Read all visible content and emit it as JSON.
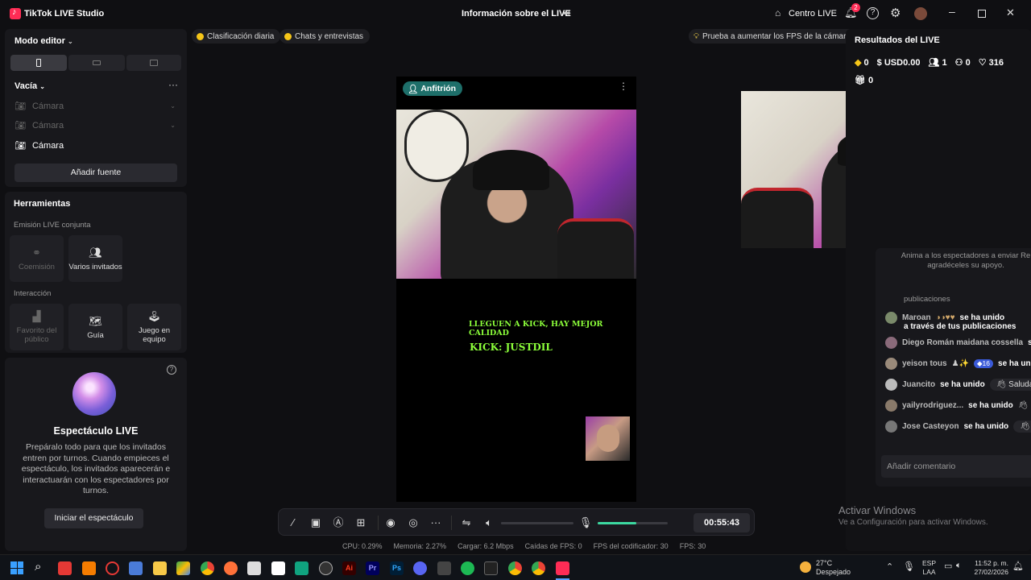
{
  "app": {
    "title": "TikTok LIVE Studio"
  },
  "header": {
    "center_title": "Información sobre el LIVE",
    "centro_live": "Centro LIVE",
    "notif_count": "2"
  },
  "left": {
    "mode_editor": "Modo editor",
    "scene_name": "Vacía",
    "sources": [
      {
        "label": "Cámara",
        "active": false
      },
      {
        "label": "Cámara",
        "active": false
      },
      {
        "label": "Cámara",
        "active": true
      }
    ],
    "add_source": "Añadir fuente",
    "tools_title": "Herramientas",
    "co_emission_title": "Emisión LIVE conjunta",
    "tools_co": [
      {
        "label": "Coemisión",
        "icon": "link-icon"
      },
      {
        "label": "Varios invitados",
        "icon": "people-icon"
      }
    ],
    "interaction_title": "Interacción",
    "tools_interaction": [
      {
        "label": "Favorito del público",
        "icon": "podium-icon"
      },
      {
        "label": "Guía",
        "icon": "map-icon"
      },
      {
        "label": "Juego en equipo",
        "icon": "joystick-icon"
      }
    ],
    "show_title": "Espectáculo LIVE",
    "show_desc": "Prepáralo todo para que los invitados entren por turnos. Cuando empieces el espectáculo, los invitados aparecerán e interactuarán con los espectadores por turnos.",
    "show_button": "Iniciar el espectáculo"
  },
  "top_chips": {
    "daily_rank": "Clasificación diaria",
    "chats": "Chats y entrevistas",
    "fps_tip": "Prueba a aumentar los FPS de la cámara"
  },
  "video": {
    "host_badge": "Anfitrión",
    "overlay_line1": "LLEGUEN A KICK, HAY MEJOR",
    "overlay_line2": "CALIDAD",
    "overlay_line3": "KICK: JUSTDIL"
  },
  "results": {
    "title": "Resultados del LIVE",
    "diamonds": "0",
    "usd": "USD0.00",
    "viewers": "1",
    "shares": "0",
    "likes": "316",
    "gifts": "0"
  },
  "chat": {
    "notice": "Anima a los espectadores a enviar Re agradéceles su apoyo.",
    "partial_line": "publicaciones",
    "entries": [
      {
        "name": "Maroan",
        "suffix": "se ha unido",
        "extra": "a través de tus publicaciones",
        "greet": ""
      },
      {
        "name": "Diego Román maidana cossella",
        "suffix": "se",
        "extra": "",
        "greet": ""
      },
      {
        "name": "yeison tous",
        "suffix": "se ha unido",
        "extra": "",
        "greet": "",
        "level": "16"
      },
      {
        "name": "Juancito",
        "suffix": "se ha unido",
        "extra": "",
        "greet": "Saluda"
      },
      {
        "name": "yailyrodriguez...",
        "suffix": "se ha unido",
        "extra": "",
        "greet": ""
      },
      {
        "name": "Jose Casteyon",
        "suffix": "se ha unido",
        "extra": "",
        "greet": "S"
      }
    ],
    "input_placeholder": "Añadir comentario"
  },
  "controls": {
    "timer": "00:55:43",
    "volume": 0.55,
    "mic": 0.55
  },
  "status": {
    "cpu": "CPU:  0.29%",
    "memory": "Memoria:  2.27%",
    "upload": "Cargar:  6.2 Mbps",
    "fps_drops": "Caídas de FPS:  0",
    "encoder_fps": "FPS del codificador:  30",
    "fps": "FPS:  30"
  },
  "watermark": {
    "line1": "Activar Windows",
    "line2": "Ve a Configuración para activar Windows."
  },
  "taskbar": {
    "weather_temp": "27°C",
    "weather_desc": "Despejado",
    "lang1": "ESP",
    "lang2": "LAA",
    "time": "11:52 p. m.",
    "date": "27/02/2026"
  },
  "colors": {
    "accent": "#fe2c55",
    "green": "#3cd9a0",
    "kick": "#8cff3a"
  }
}
